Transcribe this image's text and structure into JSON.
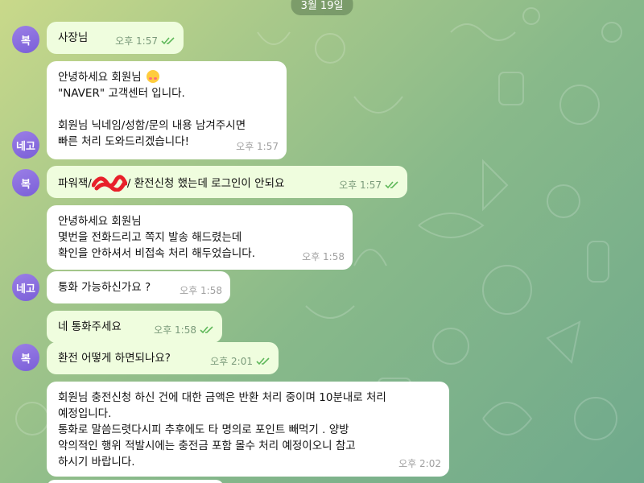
{
  "date_label": "3월 19일",
  "avatars": {
    "a1": "복",
    "a2": "네고",
    "a3": "복",
    "a4": "네고",
    "a5": "복"
  },
  "messages": {
    "m1": {
      "text": "사장님",
      "time": "오후 1:57"
    },
    "m2": {
      "line1": "안녕하세요 회원님",
      "line2": "\"NAVER\" 고객센터 입니다.",
      "line3": "회원님 닉네임/성함/문의 내용 남겨주시면",
      "line4": "빠른 처리 도와드리겠습니다!",
      "time": "오후 1:57"
    },
    "m3": {
      "prefix": "파워잭/",
      "suffix": "/ 환전신청 했는데 로그인이 안되요",
      "time": "오후 1:57"
    },
    "m4": {
      "line1": "안녕하세요 회원님",
      "line2": "몇번을 전화드리고 쪽지 발송 해드렸는데",
      "line3": "확인을 안하셔서 비접속 처리 해두었습니다.",
      "time": "오후 1:58"
    },
    "m5": {
      "text": "통화 가능하신가요 ?",
      "time": "오후 1:58"
    },
    "m6": {
      "text": "네 통화주세요",
      "time": "오후 1:58"
    },
    "m7": {
      "text": "환전 어떻게 하면되나요?",
      "time": "오후 2:01"
    },
    "m8": {
      "line1": "회원님 충전신청 하신 건에 대한 금액은 반환 처리 중이며 10분내로 처리",
      "line2": "예정입니다.",
      "line3": "통화로 말씀드렷다시피 추후에도 타 명의로 포인트 빼먹기 . 양방",
      "line4": "악의적인 행위 적발시에는 충전금 포함 몰수 처리 예정이오니 참고",
      "line5": "하시기 바랍니다.",
      "time": "오후 2:02"
    }
  },
  "colors": {
    "outgoing_bubble": "#effdde",
    "incoming_bubble": "#ffffff",
    "avatar": "#8a6fe0",
    "check_color": "#5fb85a"
  },
  "icons": {
    "read_receipt": "double-check-icon",
    "redaction": "red-scribble"
  }
}
